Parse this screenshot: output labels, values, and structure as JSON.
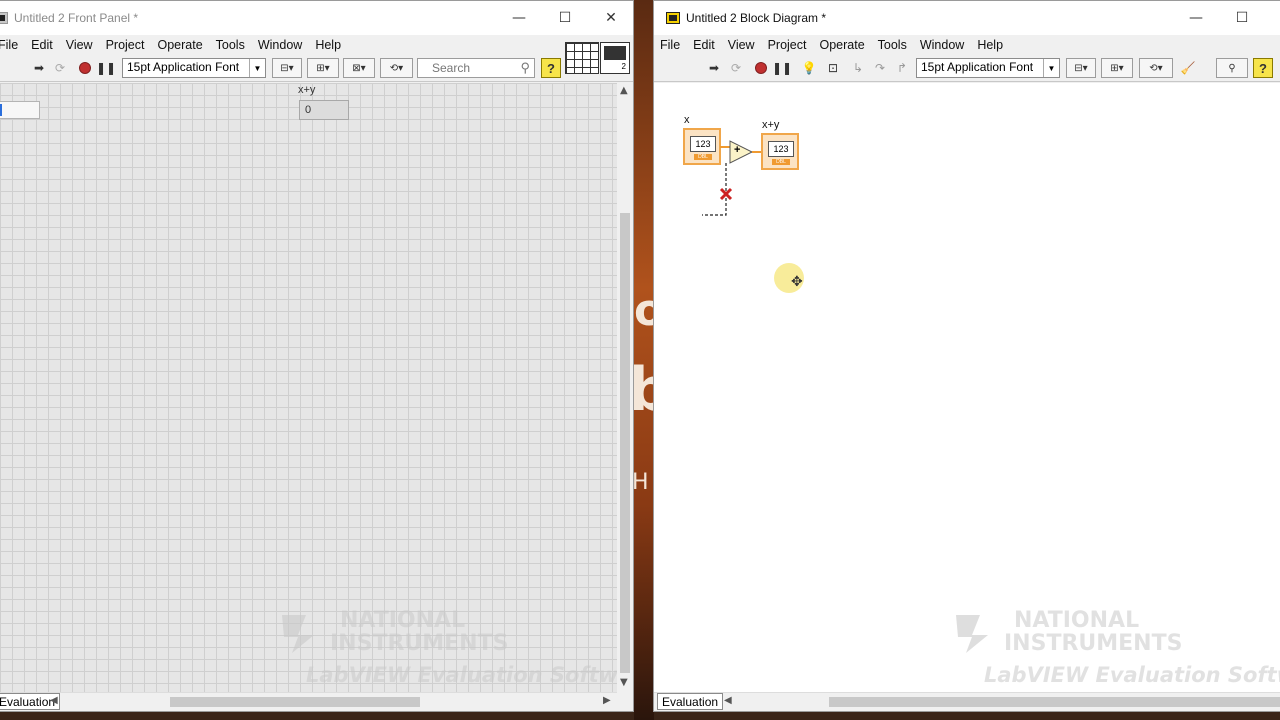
{
  "front_panel": {
    "title": "Untitled 2 Front Panel *",
    "menu": [
      "File",
      "Edit",
      "View",
      "Project",
      "Operate",
      "Tools",
      "Window",
      "Help"
    ],
    "font_selector": "15pt Application Font",
    "search_placeholder": "Search",
    "indicator_label": "x+y",
    "indicator_value": "0",
    "status_label": "Evaluation",
    "watermark": {
      "line1": "NATIONAL",
      "line2": "INSTRUMENTS",
      "line3": "LabVIEW Evaluation Software"
    }
  },
  "block_diagram": {
    "title": "Untitled 2 Block Diagram *",
    "menu": [
      "File",
      "Edit",
      "View",
      "Project",
      "Operate",
      "Tools",
      "Window",
      "Help"
    ],
    "font_selector": "15pt Application Font",
    "control_label": "x",
    "indicator_label": "x+y",
    "terminal_text": "123",
    "terminal_type": "DBL",
    "add_symbol": "+",
    "status_label": "Evaluation",
    "watermark": {
      "line1": "NATIONAL",
      "line2": "INSTRUMENTS",
      "line3": "LabVIEW Evaluation Software"
    }
  },
  "window_controls": {
    "minimize": "—",
    "maximize": "☐",
    "close": "✕"
  },
  "icons": [
    "run-arrow-icon",
    "run-continuously-icon",
    "abort-icon",
    "pause-icon",
    "highlight-execution-icon",
    "retain-wire-values-icon",
    "step-into-icon",
    "step-over-icon",
    "step-out-icon",
    "align-icon",
    "distribute-icon",
    "resize-icon",
    "reorder-icon",
    "cleanup-icon",
    "search-icon",
    "help-icon"
  ],
  "colors": {
    "terminal_border": "#f0a64a",
    "broken_wire": "#cc2222",
    "help_yellow": "#f7e44a"
  }
}
